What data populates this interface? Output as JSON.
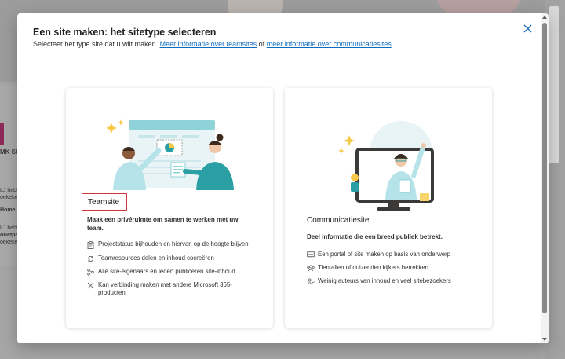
{
  "background": {
    "snippets": [
      "LJ hebt",
      "oekeke",
      "MK SH",
      "Home",
      "LJ hebt",
      "orlefpa",
      "oekeke"
    ]
  },
  "dialog": {
    "title": "Een site maken: het sitetype selecteren",
    "subtitle_prefix": "Selecteer het type site dat u wilt maken.",
    "link_team": "Meer informatie over teamsites",
    "subtitle_join": "of",
    "link_comm": "meer informatie over communicatiesites",
    "subtitle_end": "."
  },
  "cards": {
    "team": {
      "name": "Teamsite",
      "description": "Maak een privéruimte om samen te werken met uw team.",
      "features": [
        {
          "icon": "clipboard-icon",
          "text": "Projectstatus bijhouden en hiervan op de hoogte blijven"
        },
        {
          "icon": "sync-icon",
          "text": "Teamresources delen en inhoud cocreëren"
        },
        {
          "icon": "share-icon",
          "text": "Alle site-eigenaars en leden publiceren site-inhoud"
        },
        {
          "icon": "connect-icon",
          "text": "Kan verbinding maken met andere Microsoft 365-producten"
        }
      ]
    },
    "comm": {
      "name": "Communicatiesite",
      "description": "Deel informatie die een breed publiek betrekt.",
      "features": [
        {
          "icon": "portal-icon",
          "text": "Een portal of site maken op basis van onderwerp"
        },
        {
          "icon": "audience-icon",
          "text": "Tientallen of duizenden kijkers betrekken"
        },
        {
          "icon": "people-icon",
          "text": "Weinig auteurs van inhoud en veel sitebezoekers"
        }
      ]
    }
  },
  "colors": {
    "accent": "#0f6cbd",
    "highlight_border": "#d13438",
    "teal": "#2aa0a4"
  }
}
